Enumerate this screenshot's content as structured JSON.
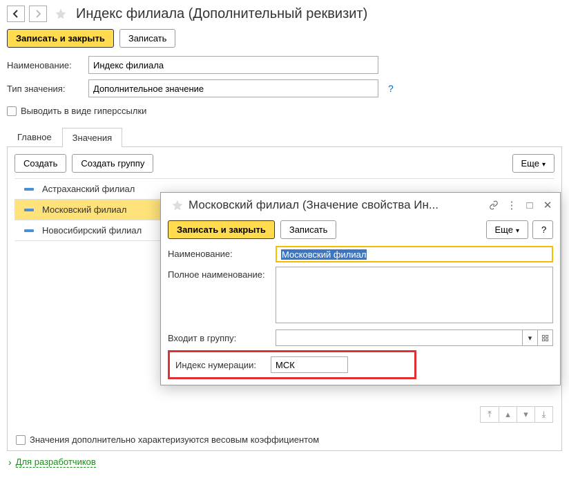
{
  "header": {
    "title": "Индекс филиала (Дополнительный реквизит)"
  },
  "toolbar": {
    "save_close": "Записать и закрыть",
    "save": "Записать"
  },
  "form": {
    "name_label": "Наименование:",
    "name_value": "Индекс филиала",
    "type_label": "Тип значения:",
    "type_value": "Дополнительное значение",
    "hyperlink_checkbox": "Выводить в виде гиперссылки"
  },
  "tabs": {
    "main": "Главное",
    "values": "Значения"
  },
  "values_panel": {
    "create": "Создать",
    "create_group": "Создать группу",
    "more": "Еще",
    "items": [
      "Астраханский филиал",
      "Московский филиал",
      "Новосибирский филиал"
    ],
    "weight_checkbox": "Значения дополнительно характеризуются весовым коэффициентом"
  },
  "dev_link": "Для разработчиков",
  "modal": {
    "title": "Московский филиал (Значение свойства Ин...",
    "save_close": "Записать и закрыть",
    "save": "Записать",
    "more": "Еще",
    "help": "?",
    "name_label": "Наименование:",
    "name_value": "Московский филиал",
    "fullname_label": "Полное наименование:",
    "fullname_value": "",
    "group_label": "Входит в группу:",
    "group_value": "",
    "index_label": "Индекс нумерации:",
    "index_value": "МСК"
  }
}
